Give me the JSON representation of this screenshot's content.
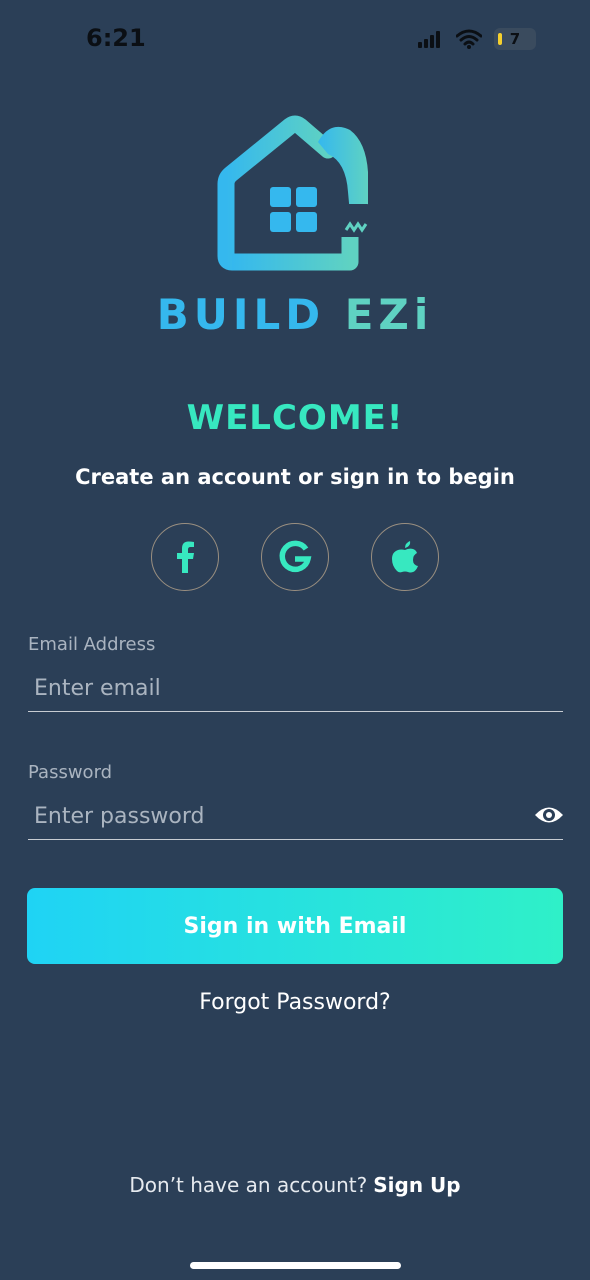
{
  "status_bar": {
    "time": "6:21",
    "battery_level": "7",
    "icons": [
      "cellular-signal-icon",
      "wifi-icon",
      "battery-icon"
    ]
  },
  "brand": {
    "name_part1": "BUILD",
    "name_part2": "EZi",
    "logo_icon": "house-hammer-logo"
  },
  "welcome": {
    "title": "WELCOME!",
    "subtitle": "Create an account or sign in to begin"
  },
  "social_logins": {
    "facebook_icon": "facebook-icon",
    "google_icon": "google-icon",
    "apple_icon": "apple-icon"
  },
  "form": {
    "email_label": "Email Address",
    "email_placeholder": "Enter email",
    "email_value": "",
    "password_label": "Password",
    "password_placeholder": "Enter password",
    "password_value": "",
    "password_toggle_icon": "eye-icon",
    "submit_label": "Sign in with Email",
    "forgot_label": "Forgot Password?"
  },
  "footer": {
    "question": "Don’t have an account?",
    "signup_label": "Sign Up"
  },
  "colors": {
    "background": "#2b3f57",
    "accent": "#37e8c0",
    "brand_blue": "#35b8ee",
    "button_gradient_start": "#1fd3f5",
    "button_gradient_end": "#2ff0c8"
  }
}
